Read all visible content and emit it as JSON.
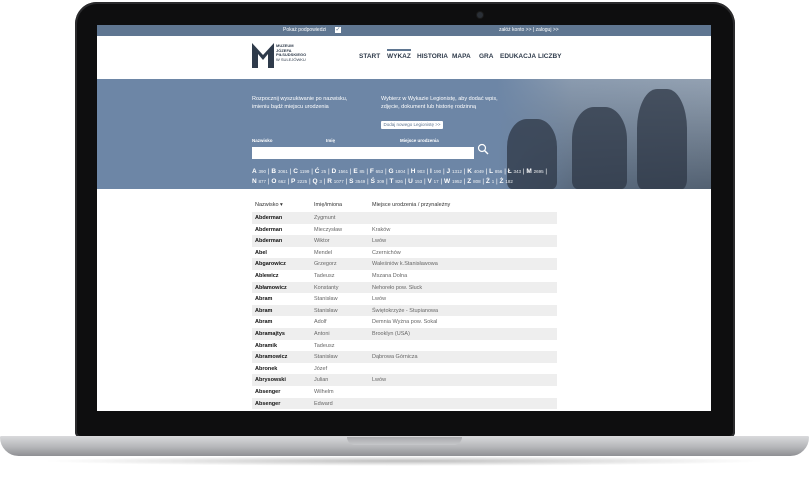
{
  "topbar": {
    "show_supporters": "Pokaż podpowiedzi",
    "account": "załóż konto >> | zaloguj >>"
  },
  "logo": {
    "line1": "MUZEUM",
    "line2": "JÓZEFA",
    "line3": "PIŁSUDSKIEGO",
    "line4": "W SULEJÓWKU"
  },
  "nav": [
    "START",
    "WYKAZ",
    "HISTORIA",
    "MAPA",
    "GRA",
    "EDUKACJA",
    "LICZBY"
  ],
  "hero": {
    "left_text": "Rozpocznij wyszukiwanie po nazwisku, imieniu bądź miejscu urodzenia",
    "right_text": "Wybierz w Wykazie Legionistę, aby dodać wpis, zdjęcie, dokument lub historię rodzinną",
    "new_button": "Dodaj nowego Legionistę >>",
    "labels": {
      "surname": "Nazwisko",
      "name": "Imię",
      "place": "Miejsce urodzenia"
    }
  },
  "alphabet": [
    {
      "l": "A",
      "n": "390"
    },
    {
      "l": "B",
      "n": "3061"
    },
    {
      "l": "C",
      "n": "1199"
    },
    {
      "l": "Ć",
      "n": "25"
    },
    {
      "l": "D",
      "n": "1561"
    },
    {
      "l": "E",
      "n": "85"
    },
    {
      "l": "F",
      "n": "653"
    },
    {
      "l": "G",
      "n": "1804"
    },
    {
      "l": "H",
      "n": "903"
    },
    {
      "l": "I",
      "n": "190"
    },
    {
      "l": "J",
      "n": "1312"
    },
    {
      "l": "K",
      "n": "4049"
    },
    {
      "l": "L",
      "n": "856"
    },
    {
      "l": "Ł",
      "n": "343"
    },
    {
      "l": "M",
      "n": "2695"
    },
    {
      "l": "N",
      "n": "877"
    },
    {
      "l": "O",
      "n": "662"
    },
    {
      "l": "P",
      "n": "2225"
    },
    {
      "l": "Q",
      "n": "3"
    },
    {
      "l": "R",
      "n": "1077"
    },
    {
      "l": "S",
      "n": "3549"
    },
    {
      "l": "Ś",
      "n": "309"
    },
    {
      "l": "T",
      "n": "826"
    },
    {
      "l": "U",
      "n": "153"
    },
    {
      "l": "V",
      "n": "17"
    },
    {
      "l": "W",
      "n": "1952"
    },
    {
      "l": "Z",
      "n": "808"
    },
    {
      "l": "Ż",
      "n": "1"
    },
    {
      "l": "Ż",
      "n": "182"
    }
  ],
  "table": {
    "headers": [
      "Nazwisko ▾",
      "Imię/imiona",
      "Miejsce urodzenia / przynależny"
    ],
    "rows": [
      [
        "Abderman",
        "Zygmunt",
        ""
      ],
      [
        "Abderman",
        "Mieczysław",
        "Kraków"
      ],
      [
        "Abderman",
        "Wiktor",
        "Lwów"
      ],
      [
        "Abel",
        "Mendel",
        "Czernichów"
      ],
      [
        "Abgarowicz",
        "Grzegorz",
        "Waleśniów k.Stanisławowa"
      ],
      [
        "Ablewicz",
        "Tadeusz",
        "Mszana Dolna"
      ],
      [
        "Abłamowicz",
        "Konstanty",
        "Nehoreło pow. Słuck"
      ],
      [
        "Abram",
        "Stanisław",
        "Lwów"
      ],
      [
        "Abram",
        "Stanisław",
        "Świętokrzyże - Stupianowa"
      ],
      [
        "Abram",
        "Adolf",
        "Demnia Wyżna pow. Sokal"
      ],
      [
        "Abramajtys",
        "Antoni",
        "Brooklyn (USA)"
      ],
      [
        "Abramik",
        "Tadeusz",
        ""
      ],
      [
        "Abramowicz",
        "Stanisław",
        "Dąbrowa Górnicza"
      ],
      [
        "Abronek",
        "Józef",
        ""
      ],
      [
        "Abrysowski",
        "Julian",
        "Lwów"
      ],
      [
        "Absenger",
        "Wilhelm",
        ""
      ],
      [
        "Absenger",
        "Edward",
        ""
      ]
    ]
  },
  "colors": {
    "header_blue": "#5f7691",
    "hero_blue": "#6d86a6",
    "text_dark": "#2f3b4b"
  }
}
